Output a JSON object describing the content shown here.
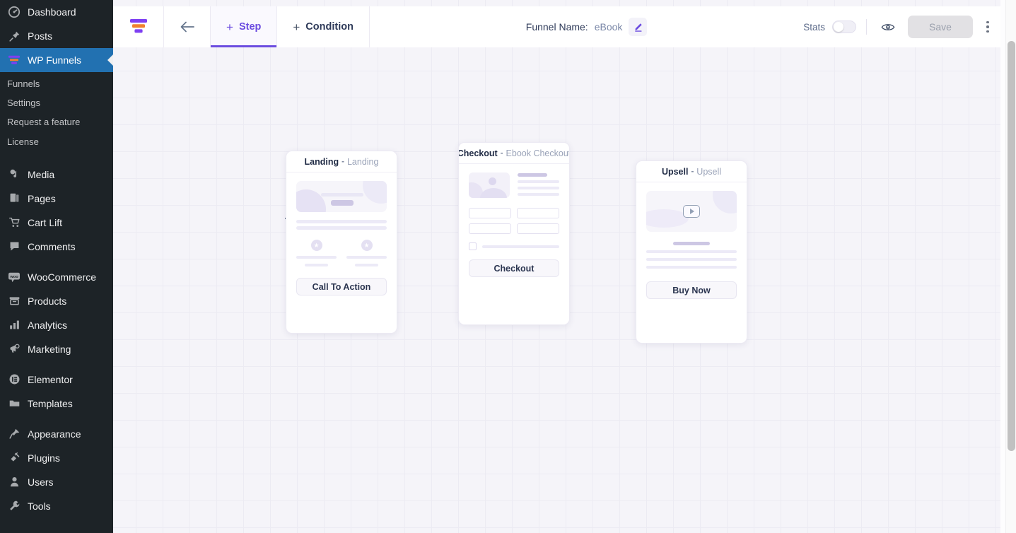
{
  "wp_sidebar": {
    "items": [
      {
        "label": "Dashboard",
        "icon": "dashboard-icon",
        "current": false
      },
      {
        "label": "Posts",
        "icon": "pin-icon",
        "current": false
      },
      {
        "label": "WP Funnels",
        "icon": "funnel-icon",
        "current": true
      }
    ],
    "submenu": [
      {
        "label": "Funnels"
      },
      {
        "label": "Settings"
      },
      {
        "label": "Request a feature"
      },
      {
        "label": "License"
      }
    ],
    "group_two": [
      {
        "label": "Media",
        "icon": "media-icon"
      },
      {
        "label": "Pages",
        "icon": "pages-icon"
      },
      {
        "label": "Cart Lift",
        "icon": "cart-icon"
      },
      {
        "label": "Comments",
        "icon": "comments-icon"
      }
    ],
    "group_three": [
      {
        "label": "WooCommerce",
        "icon": "woocommerce-icon"
      },
      {
        "label": "Products",
        "icon": "products-icon"
      },
      {
        "label": "Analytics",
        "icon": "analytics-icon"
      },
      {
        "label": "Marketing",
        "icon": "marketing-icon"
      }
    ],
    "group_four": [
      {
        "label": "Elementor",
        "icon": "elementor-icon"
      },
      {
        "label": "Templates",
        "icon": "templates-icon"
      }
    ],
    "group_five": [
      {
        "label": "Appearance",
        "icon": "appearance-icon"
      },
      {
        "label": "Plugins",
        "icon": "plugins-icon"
      },
      {
        "label": "Users",
        "icon": "users-icon"
      },
      {
        "label": "Tools",
        "icon": "tools-icon"
      }
    ]
  },
  "toolbar": {
    "logo_icon": "wp-funnels-logo-icon",
    "back_icon": "back-arrow-icon",
    "step_tab": "Step",
    "condition_tab": "Condition",
    "plus_glyph": "+",
    "funnel_name_label": "Funnel Name:",
    "funnel_name_value": "eBook",
    "edit_icon": "pencil-edit-icon",
    "stats_label": "Stats",
    "stats_enabled": false,
    "preview_icon": "eye-preview-icon",
    "save_label": "Save",
    "save_disabled": true,
    "more_icon": "kebab-menu-icon",
    "accent_color": "#6c4de0"
  },
  "canvas": {
    "grid_size": 38,
    "background_color": "#f5f4f9",
    "grid_line_color": "#ecebf3",
    "nodes": [
      {
        "type": "landing",
        "title": "Landing",
        "separator": "-",
        "subtitle": "Landing",
        "cta_label": "Call To Action"
      },
      {
        "type": "checkout",
        "title": "Checkout",
        "separator": "-",
        "subtitle": "Ebook Checkout",
        "cta_label": "Checkout"
      },
      {
        "type": "upsell",
        "title": "Upsell",
        "separator": "-",
        "subtitle": "Upsell",
        "cta_label": "Buy Now",
        "media_icon": "play-video-icon"
      }
    ],
    "edge_color": "#6d7c90"
  },
  "scrollbar": {
    "name": "vertical-scrollbar"
  }
}
